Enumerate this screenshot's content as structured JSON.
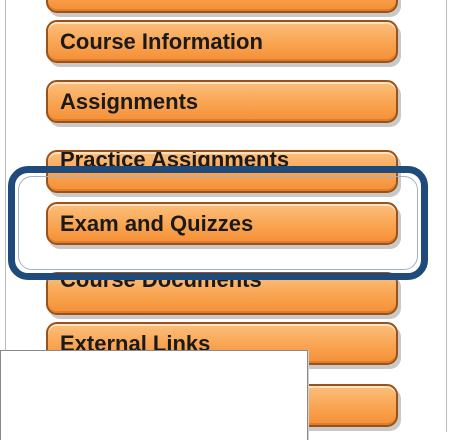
{
  "navigation": {
    "items": [
      {
        "label": ""
      },
      {
        "label": "Course Information"
      },
      {
        "label": "Assignments"
      },
      {
        "label": "Practice Assignments"
      },
      {
        "label": "Exam and Quizzes"
      },
      {
        "label": "Course Documents"
      },
      {
        "label": "External Links"
      },
      {
        "label": ""
      }
    ]
  },
  "colors": {
    "button_fill": "#f9a451",
    "button_border": "#9a5218",
    "highlight_border": "#1e4a7c"
  }
}
